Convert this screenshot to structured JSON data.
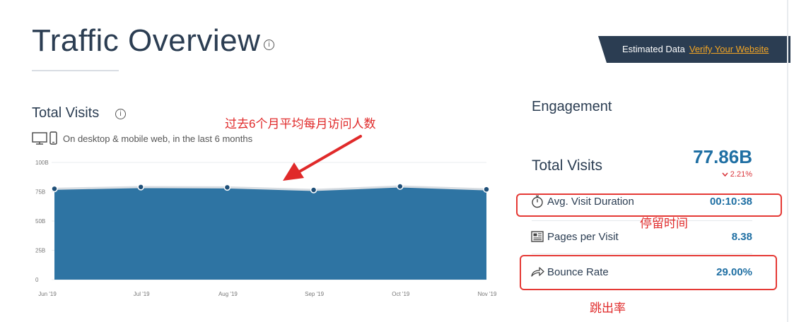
{
  "page": {
    "title": "Traffic Overview",
    "info_glyph": "i"
  },
  "banner": {
    "label": "Estimated Data",
    "link": "Verify Your Website",
    "bg_color": "#2b3d52",
    "link_color": "#f5a623"
  },
  "total_visits_section": {
    "title": "Total Visits",
    "subtitle": "On desktop & mobile web, in the last 6 months",
    "icons": [
      "desktop-icon",
      "mobile-icon",
      "info-icon"
    ]
  },
  "annotations": {
    "chart_note": "过去6个月平均每月访问人数",
    "duration_note": "停留时间",
    "bounce_note": "跳出率",
    "color": "#e02a2a"
  },
  "engagement": {
    "title": "Engagement",
    "total_visits_label": "Total Visits",
    "total_visits_value": "77.86B",
    "total_visits_change": "2.21%",
    "change_direction": "down",
    "metrics": [
      {
        "label": "Avg. Visit Duration",
        "value": "00:10:38",
        "icon": "stopwatch-icon"
      },
      {
        "label": "Pages per Visit",
        "value": "8.38",
        "icon": "pages-icon"
      },
      {
        "label": "Bounce Rate",
        "value": "29.00%",
        "icon": "bounce-arrow-icon"
      }
    ],
    "value_color": "#1f6fa3"
  },
  "chart_data": {
    "type": "area",
    "categories": [
      "Jun '19",
      "Jul '19",
      "Aug '19",
      "Sep '19",
      "Oct '19",
      "Nov '19"
    ],
    "series": [
      {
        "values": [
          77.5,
          79,
          78.7,
          76.5,
          79.5,
          77
        ]
      }
    ],
    "yticks": [
      0,
      25,
      50,
      75,
      100
    ],
    "ytick_labels": [
      "0",
      "25B",
      "50B",
      "75B",
      "100B"
    ],
    "ylim": [
      0,
      100
    ],
    "grid": true,
    "fill_color": "#2e74a3",
    "line_color": "#d8dde2"
  }
}
